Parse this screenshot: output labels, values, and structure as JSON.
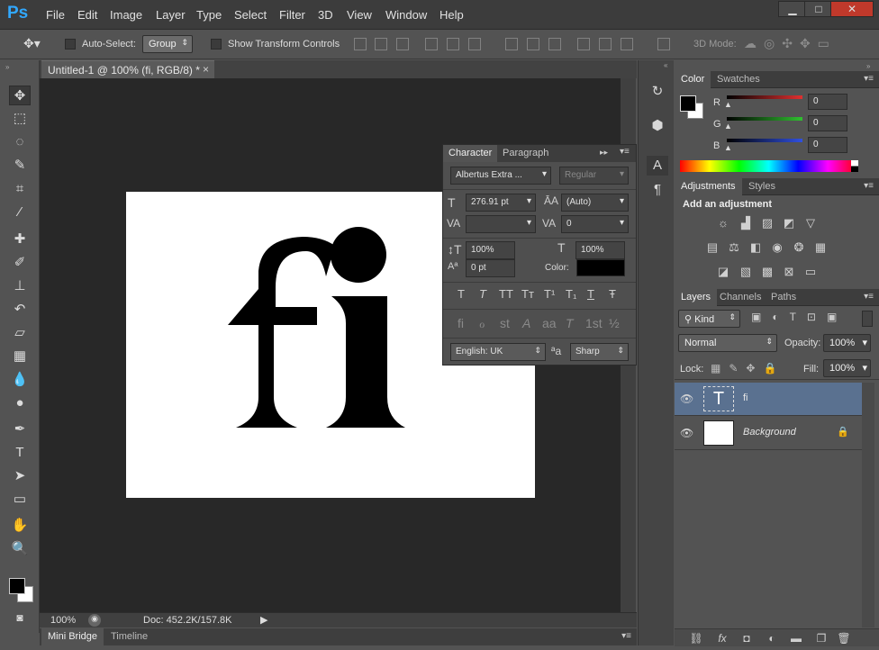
{
  "menubar": {
    "logo": "Ps",
    "items": [
      "File",
      "Edit",
      "Image",
      "Layer",
      "Type",
      "Select",
      "Filter",
      "3D",
      "View",
      "Window",
      "Help"
    ],
    "window_buttons": {
      "minimize": "▁",
      "maximize": "□",
      "close": "✕"
    }
  },
  "options_bar": {
    "auto_select_label": "Auto-Select:",
    "group_value": "Group",
    "show_transform_label": "Show Transform Controls",
    "mode_3d_label": "3D Mode:"
  },
  "document_tab": {
    "title": "Untitled-1 @ 100% (fi, RGB/8) *",
    "close": "×"
  },
  "canvas": {
    "glyph_text": "fi",
    "doc_bg": "#ffffff",
    "canvas_bg": "#282828"
  },
  "status": {
    "zoom": "100%",
    "doc_info": "Doc: 452.2K/157.8K"
  },
  "bottom_tabs": [
    "Mini Bridge",
    "Timeline"
  ],
  "character_panel": {
    "tabs": [
      "Character",
      "Paragraph"
    ],
    "font_family": "Albertus Extra ...",
    "font_style": "Regular",
    "font_size": "276.91 pt",
    "leading": "(Auto)",
    "kerning": "",
    "tracking": "0",
    "vscale": "100%",
    "hscale": "100%",
    "baseline": "0 pt",
    "color_label": "Color:",
    "language": "English: UK",
    "antialias": "Sharp",
    "style_buttons": [
      "T",
      "T",
      "TT",
      "Tт",
      "T¹",
      "T₁",
      "T",
      "Ŧ"
    ],
    "opentype_buttons": [
      "fi",
      "ℴ",
      "st",
      "A",
      "aa",
      "T",
      "1st",
      "½"
    ]
  },
  "color_panel": {
    "tabs": [
      "Color",
      "Swatches"
    ],
    "channels": [
      {
        "label": "R",
        "value": "0",
        "color": "#e03030"
      },
      {
        "label": "G",
        "value": "0",
        "color": "#30c030"
      },
      {
        "label": "B",
        "value": "0",
        "color": "#3050e0"
      }
    ]
  },
  "adjustments_panel": {
    "tabs": [
      "Adjustments",
      "Styles"
    ],
    "title": "Add an adjustment"
  },
  "layers_panel": {
    "tabs": [
      "Layers",
      "Channels",
      "Paths"
    ],
    "kind_label": "Kind",
    "blend_mode": "Normal",
    "opacity_label": "Opacity:",
    "opacity_value": "100%",
    "lock_label": "Lock:",
    "fill_label": "Fill:",
    "fill_value": "100%",
    "layers": [
      {
        "name": "fi",
        "type": "text",
        "thumb": "T",
        "selected": true
      },
      {
        "name": "Background",
        "type": "raster",
        "thumb": "",
        "selected": false
      }
    ],
    "bottom_icons": [
      "link-icon",
      "fx-icon",
      "mask-icon",
      "adjustment-icon",
      "folder-icon",
      "new-layer-icon",
      "trash-icon"
    ],
    "fx_label": "fx"
  }
}
